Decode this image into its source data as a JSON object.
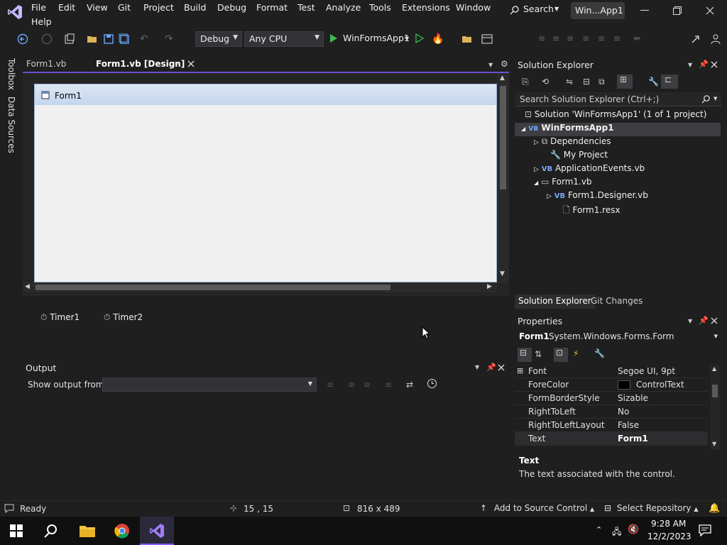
{
  "menu": {
    "items": [
      "File",
      "Edit",
      "View",
      "Git",
      "Project",
      "Build",
      "Debug",
      "Format",
      "Test",
      "Analyze",
      "Tools",
      "Extensions",
      "Window",
      "Help"
    ],
    "search": "Search",
    "window_title": "Win...App1"
  },
  "toolbar": {
    "config": "Debug",
    "platform": "Any CPU",
    "start_label": "WinFormsApp1"
  },
  "left_strip": {
    "toolbox": "Toolbox",
    "data_sources": "Data Sources"
  },
  "doc_tabs": [
    {
      "label": "Form1.vb"
    },
    {
      "label": "Form1.vb [Design]"
    }
  ],
  "designer": {
    "form_title": "Form1"
  },
  "tray": {
    "timer1": "Timer1",
    "timer2": "Timer2"
  },
  "output": {
    "title": "Output",
    "show_from": "Show output from:"
  },
  "solution_explorer": {
    "title": "Solution Explorer",
    "search_placeholder": "Search Solution Explorer (Ctrl+;)",
    "tree": [
      "Solution 'WinFormsApp1' (1 of 1 project)",
      "WinFormsApp1",
      "Dependencies",
      "My Project",
      "ApplicationEvents.vb",
      "Form1.vb",
      "Form1.Designer.vb",
      "Form1.resx"
    ],
    "bottom_tabs": [
      "Solution Explorer",
      "Git Changes"
    ]
  },
  "properties": {
    "title": "Properties",
    "object_name": "Form1",
    "object_type": "System.Windows.Forms.Form",
    "rows": [
      {
        "name": "Font",
        "value": "Segoe UI, 9pt"
      },
      {
        "name": "ForeColor",
        "value": "ControlText"
      },
      {
        "name": "FormBorderStyle",
        "value": "Sizable"
      },
      {
        "name": "RightToLeft",
        "value": "No"
      },
      {
        "name": "RightToLeftLayout",
        "value": "False"
      },
      {
        "name": "Text",
        "value": "Form1"
      }
    ],
    "desc_title": "Text",
    "desc_text": "The text associated with the control."
  },
  "statusbar": {
    "ready": "Ready",
    "position": "15 , 15",
    "size": "816 x 489",
    "source_control": "Add to Source Control",
    "repository": "Select Repository"
  },
  "taskbar": {
    "time": "9:28 AM",
    "date": "12/2/2023"
  },
  "colors": {
    "accent": "#6f4fcf",
    "vs_purple": "#8a5cf5",
    "selection": "#3e3e42"
  }
}
